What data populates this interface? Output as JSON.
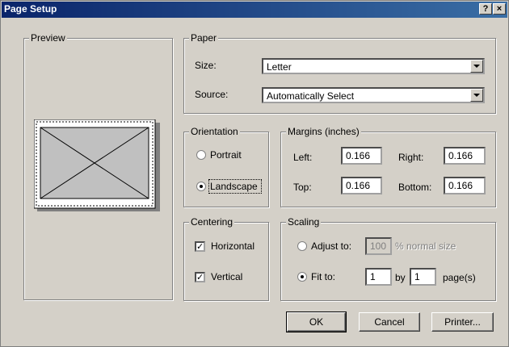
{
  "window": {
    "title": "Page Setup",
    "help_label": "?",
    "close_label": "×"
  },
  "preview": {
    "legend": "Preview"
  },
  "paper": {
    "legend": "Paper",
    "size_label": "Size:",
    "size_value": "Letter",
    "source_label": "Source:",
    "source_value": "Automatically Select"
  },
  "orientation": {
    "legend": "Orientation",
    "portrait_label": "Portrait",
    "landscape_label": "Landscape",
    "selected": "Landscape"
  },
  "margins": {
    "legend": "Margins (inches)",
    "left_label": "Left:",
    "left_value": "0.166",
    "right_label": "Right:",
    "right_value": "0.166",
    "top_label": "Top:",
    "top_value": "0.166",
    "bottom_label": "Bottom:",
    "bottom_value": "0.166"
  },
  "centering": {
    "legend": "Centering",
    "horizontal_label": "Horizontal",
    "horizontal_checked": true,
    "vertical_label": "Vertical",
    "vertical_checked": true
  },
  "scaling": {
    "legend": "Scaling",
    "adjust_label": "Adjust to:",
    "adjust_value": "100",
    "normal_size_label": "% normal size",
    "fit_label": "Fit to:",
    "fit_wide": "1",
    "by_label": "by",
    "fit_tall": "1",
    "pages_label": "page(s)",
    "selected": "Fit to"
  },
  "buttons": {
    "ok": "OK",
    "cancel": "Cancel",
    "printer": "Printer..."
  }
}
